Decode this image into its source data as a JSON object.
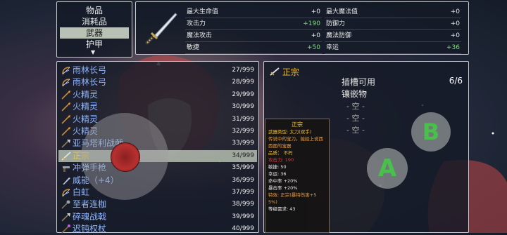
{
  "categories": {
    "items": [
      "物品",
      "消耗品",
      "武器",
      "护甲"
    ],
    "selected_index": 2
  },
  "weapon_stats": {
    "left": [
      {
        "label": "最大生命值",
        "value": "+0",
        "up": false
      },
      {
        "label": "攻击力",
        "value": "+190",
        "up": true
      },
      {
        "label": "魔法攻击",
        "value": "+0",
        "up": false
      },
      {
        "label": "敏捷",
        "value": "+50",
        "up": true
      }
    ],
    "right": [
      {
        "label": "最大魔法值",
        "value": "+0",
        "up": false
      },
      {
        "label": "防御力",
        "value": "+0",
        "up": false
      },
      {
        "label": "魔法防御",
        "value": "+0",
        "up": false
      },
      {
        "label": "幸运",
        "value": "+36",
        "up": true
      }
    ]
  },
  "item_list": [
    {
      "name": "雨林长弓",
      "count": "27/999",
      "icon": "bow-icon"
    },
    {
      "name": "雨林长弓",
      "count": "28/999",
      "icon": "bow-icon"
    },
    {
      "name": "火精灵",
      "count": "29/999",
      "icon": "spear-icon"
    },
    {
      "name": "火精灵",
      "count": "30/999",
      "icon": "spear-icon"
    },
    {
      "name": "火精灵",
      "count": "31/999",
      "icon": "spear-icon"
    },
    {
      "name": "火精灵",
      "count": "32/999",
      "icon": "spear-icon"
    },
    {
      "name": "亚马塔利战戟",
      "count": "33/999",
      "icon": "halberd-icon"
    },
    {
      "name": "正宗",
      "count": "34/999",
      "icon": "sword-icon"
    },
    {
      "name": "冲弹手枪",
      "count": "35/999",
      "icon": "gun-icon"
    },
    {
      "name": "威能（+4）",
      "count": "36/999",
      "icon": "blade-icon"
    },
    {
      "name": "白虹",
      "count": "37/999",
      "icon": "bow-icon"
    },
    {
      "name": "至者连枷",
      "count": "38/999",
      "icon": "flail-icon"
    },
    {
      "name": "碎魂战戟",
      "count": "39/999",
      "icon": "halberd-icon"
    },
    {
      "name": "迟钝权杖",
      "count": "40/999",
      "icon": "staff-icon"
    }
  ],
  "selected_item_index": 7,
  "detail": {
    "title": "正宗",
    "socket_title": "插槽可用",
    "socket_sub": "镶嵌物",
    "socket_count": "6/6",
    "slots": [
      "- 空 -",
      "- 空 -",
      "- 空 -"
    ]
  },
  "tooltip": {
    "title": "正宗",
    "lines": [
      {
        "text": "武器类型: 太刀(双手)",
        "color": "#f0c030"
      },
      {
        "text": "传说中的宝刀。能经上说西",
        "color": "#e89a40"
      },
      {
        "text": "西面的宝器",
        "color": "#e89a40"
      },
      {
        "text": "品质：  不朽",
        "color": "#f0c030"
      },
      {
        "text": "攻击力: 190",
        "color": "#e03a3a"
      },
      {
        "text": "敏捷: 50",
        "color": "#e8e8e8"
      },
      {
        "text": "幸运: 36",
        "color": "#e8e8e8"
      },
      {
        "text": "命中率 +20%",
        "color": "#e8e8e8"
      },
      {
        "text": "暴击率 +20%",
        "color": "#e8e8e8"
      },
      {
        "text": "特效: 正宗(暴特伤害+5",
        "color": "#e89a40"
      },
      {
        "text": "5%)",
        "color": "#e89a40"
      },
      {
        "text": "等级需求: 43",
        "color": "#e8e8e8"
      }
    ]
  },
  "controls": {
    "btn_a": "A",
    "btn_b": "B"
  },
  "arrows": {
    "down": "▼",
    "up": "▲"
  }
}
